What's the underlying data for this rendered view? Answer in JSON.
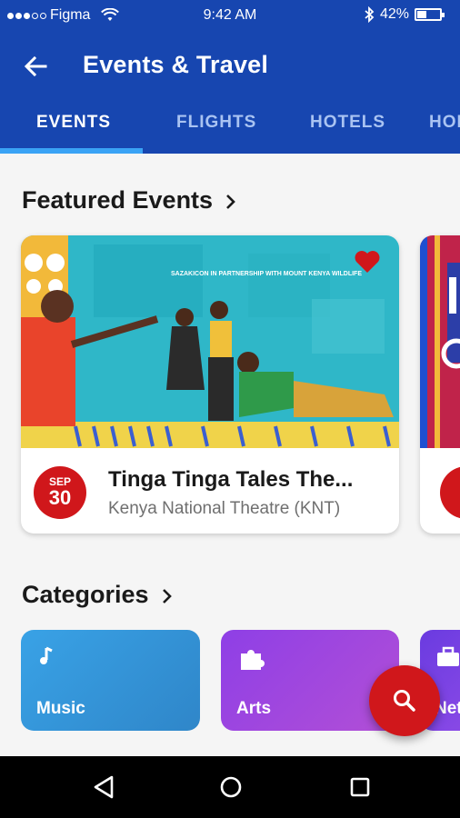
{
  "status_bar": {
    "carrier": "Figma",
    "time": "9:42 AM",
    "battery_percent": "42%",
    "battery_level": 0.42,
    "icons": [
      "signal-dots-icon",
      "wifi-icon",
      "bluetooth-icon",
      "battery-icon"
    ]
  },
  "app_bar": {
    "title": "Events & Travel",
    "back_icon": "arrow-back-icon"
  },
  "tabs": [
    {
      "label": "EVENTS",
      "active": true
    },
    {
      "label": "FLIGHTS",
      "active": false
    },
    {
      "label": "HOTELS",
      "active": false
    },
    {
      "label": "HOLIDAYS",
      "active": false
    }
  ],
  "featured": {
    "title": "Featured Events",
    "events": [
      {
        "month": "SEP",
        "day": "30",
        "title": "Tinga Tinga Tales The...",
        "venue": "Kenya National Theatre (KNT)",
        "banner_text": "SAZAKICON IN PARTNERSHIP WITH MOUNT KENYA WILDLIFE",
        "favorited": true
      }
    ]
  },
  "categories": {
    "title": "Categories",
    "items": [
      {
        "label": "Music",
        "icon": "music-note-icon",
        "color": "#3aa0e0"
      },
      {
        "label": "Arts",
        "icon": "puzzle-icon",
        "color": "#8a3be0"
      },
      {
        "label": "Networking",
        "icon": "briefcase-icon",
        "color": "#6a3be0"
      }
    ]
  },
  "fab": {
    "icon": "search-icon",
    "color": "#d0171b"
  },
  "nav_bar": {
    "icons": [
      "back-triangle-icon",
      "home-circle-icon",
      "recents-square-icon"
    ]
  },
  "colors": {
    "primary": "#1746b0",
    "tab_indicator": "#3aa3f5",
    "accent_red": "#d0171b"
  }
}
